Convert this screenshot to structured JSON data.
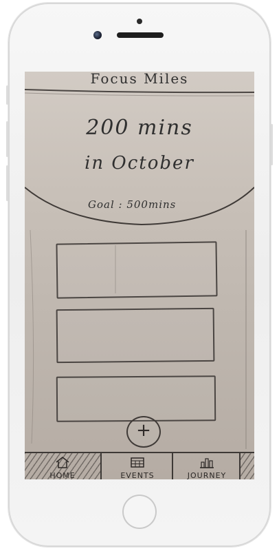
{
  "app": {
    "title": "Focus Miles"
  },
  "summary": {
    "minutes": "200 mins",
    "month": "in October",
    "goal": "Goal : 500mins"
  },
  "cards": [
    {
      "id": "card-1"
    },
    {
      "id": "card-2"
    },
    {
      "id": "card-3"
    }
  ],
  "add_button": {
    "symbol": "+"
  },
  "tabs": [
    {
      "label": "HOME",
      "icon": "home-icon",
      "active": true
    },
    {
      "label": "EVENTS",
      "icon": "calendar-icon",
      "active": false
    },
    {
      "label": "JOURNEY",
      "icon": "bar-chart-icon",
      "active": false
    }
  ],
  "colors": {
    "paper": "#c8c0b8",
    "ink": "#2f2f2f",
    "phone_body": "#f2f2f2"
  }
}
